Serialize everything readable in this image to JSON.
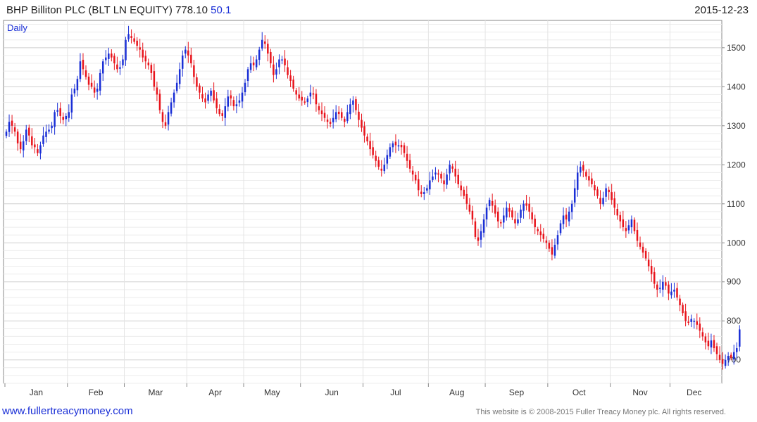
{
  "header": {
    "title": "BHP Billiton PLC (BLT LN EQUITY) 778.10",
    "change": "50.1",
    "date": "2015-12-23"
  },
  "footer": {
    "site": "www.fullertreacymoney.com",
    "copyright": "This website is © 2008-2015 Fuller Treacy Money plc. All rights reserved."
  },
  "colors": {
    "up": "#1a2fd6",
    "down": "#e8141c",
    "grid": "#cfcfcf",
    "border": "#8a8a8a"
  },
  "chart_data": {
    "type": "candlestick",
    "period_label": "Daily",
    "ylim": [
      640,
      1570
    ],
    "y_ticks": [
      700,
      800,
      900,
      1000,
      1100,
      1200,
      1300,
      1400,
      1500
    ],
    "months": [
      {
        "label": "Jan",
        "start": 0
      },
      {
        "label": "Feb",
        "start": 22
      },
      {
        "label": "Mar",
        "start": 42
      },
      {
        "label": "Apr",
        "start": 64
      },
      {
        "label": "May",
        "start": 84
      },
      {
        "label": "Jun",
        "start": 104
      },
      {
        "label": "Jul",
        "start": 126
      },
      {
        "label": "Aug",
        "start": 149
      },
      {
        "label": "Sep",
        "start": 169
      },
      {
        "label": "Oct",
        "start": 191
      },
      {
        "label": "Nov",
        "start": 213
      },
      {
        "label": "Dec",
        "start": 234
      }
    ],
    "total_bars": 251,
    "closes": [
      1285,
      1310,
      1300,
      1285,
      1255,
      1240,
      1260,
      1290,
      1275,
      1250,
      1245,
      1230,
      1250,
      1275,
      1285,
      1290,
      1300,
      1335,
      1340,
      1325,
      1315,
      1325,
      1335,
      1380,
      1395,
      1420,
      1465,
      1445,
      1425,
      1405,
      1400,
      1385,
      1395,
      1435,
      1465,
      1475,
      1485,
      1475,
      1460,
      1445,
      1450,
      1470,
      1520,
      1535,
      1525,
      1515,
      1505,
      1495,
      1475,
      1465,
      1455,
      1435,
      1400,
      1380,
      1340,
      1310,
      1300,
      1335,
      1360,
      1385,
      1410,
      1445,
      1480,
      1495,
      1480,
      1460,
      1425,
      1400,
      1385,
      1370,
      1360,
      1380,
      1390,
      1365,
      1345,
      1330,
      1325,
      1350,
      1375,
      1370,
      1350,
      1355,
      1365,
      1385,
      1410,
      1445,
      1460,
      1455,
      1470,
      1495,
      1520,
      1510,
      1485,
      1460,
      1430,
      1445,
      1470,
      1470,
      1455,
      1430,
      1415,
      1395,
      1380,
      1370,
      1365,
      1360,
      1370,
      1385,
      1380,
      1355,
      1340,
      1330,
      1320,
      1310,
      1305,
      1320,
      1335,
      1330,
      1320,
      1310,
      1335,
      1355,
      1365,
      1340,
      1315,
      1295,
      1275,
      1260,
      1240,
      1225,
      1210,
      1195,
      1185,
      1200,
      1225,
      1245,
      1255,
      1250,
      1250,
      1245,
      1230,
      1210,
      1190,
      1175,
      1160,
      1135,
      1125,
      1130,
      1140,
      1160,
      1170,
      1180,
      1175,
      1165,
      1150,
      1175,
      1200,
      1190,
      1170,
      1150,
      1135,
      1120,
      1100,
      1080,
      1060,
      1015,
      1005,
      1030,
      1060,
      1090,
      1110,
      1095,
      1075,
      1055,
      1050,
      1070,
      1090,
      1080,
      1065,
      1050,
      1060,
      1085,
      1100,
      1095,
      1080,
      1060,
      1040,
      1030,
      1020,
      1010,
      1000,
      985,
      970,
      995,
      1020,
      1050,
      1070,
      1060,
      1080,
      1100,
      1140,
      1180,
      1195,
      1185,
      1170,
      1160,
      1150,
      1135,
      1120,
      1100,
      1115,
      1140,
      1130,
      1110,
      1090,
      1070,
      1055,
      1040,
      1030,
      1045,
      1060,
      1030,
      1005,
      990,
      975,
      960,
      940,
      920,
      895,
      880,
      885,
      900,
      890,
      870,
      875,
      880,
      860,
      840,
      820,
      800,
      795,
      805,
      800,
      790,
      775,
      760,
      745,
      735,
      750,
      730,
      715,
      700,
      690,
      700,
      710,
      705,
      720,
      730,
      778
    ]
  }
}
